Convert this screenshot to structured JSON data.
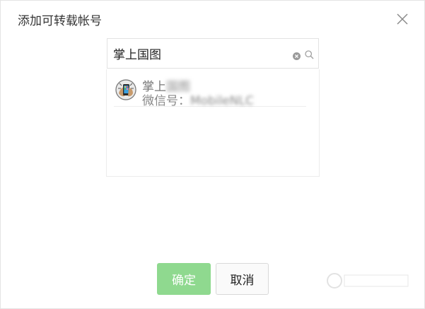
{
  "dialog": {
    "title": "添加可转载帐号",
    "close_icon": "close-icon"
  },
  "search": {
    "value": "掌上国图",
    "clear_icon": "clear-circle-icon",
    "search_icon": "search-icon"
  },
  "results": [
    {
      "avatar_icon": "mobile-phone-avatar-icon",
      "name_visible": "掌上",
      "name_blurred": "国图",
      "id_label": "微信号：",
      "id_value": "MobileNLC"
    }
  ],
  "buttons": {
    "confirm": "确定",
    "cancel": "取消"
  },
  "colors": {
    "confirm_bg": "#8fd98f",
    "border": "#e2e2e2",
    "title_text": "#353535"
  }
}
